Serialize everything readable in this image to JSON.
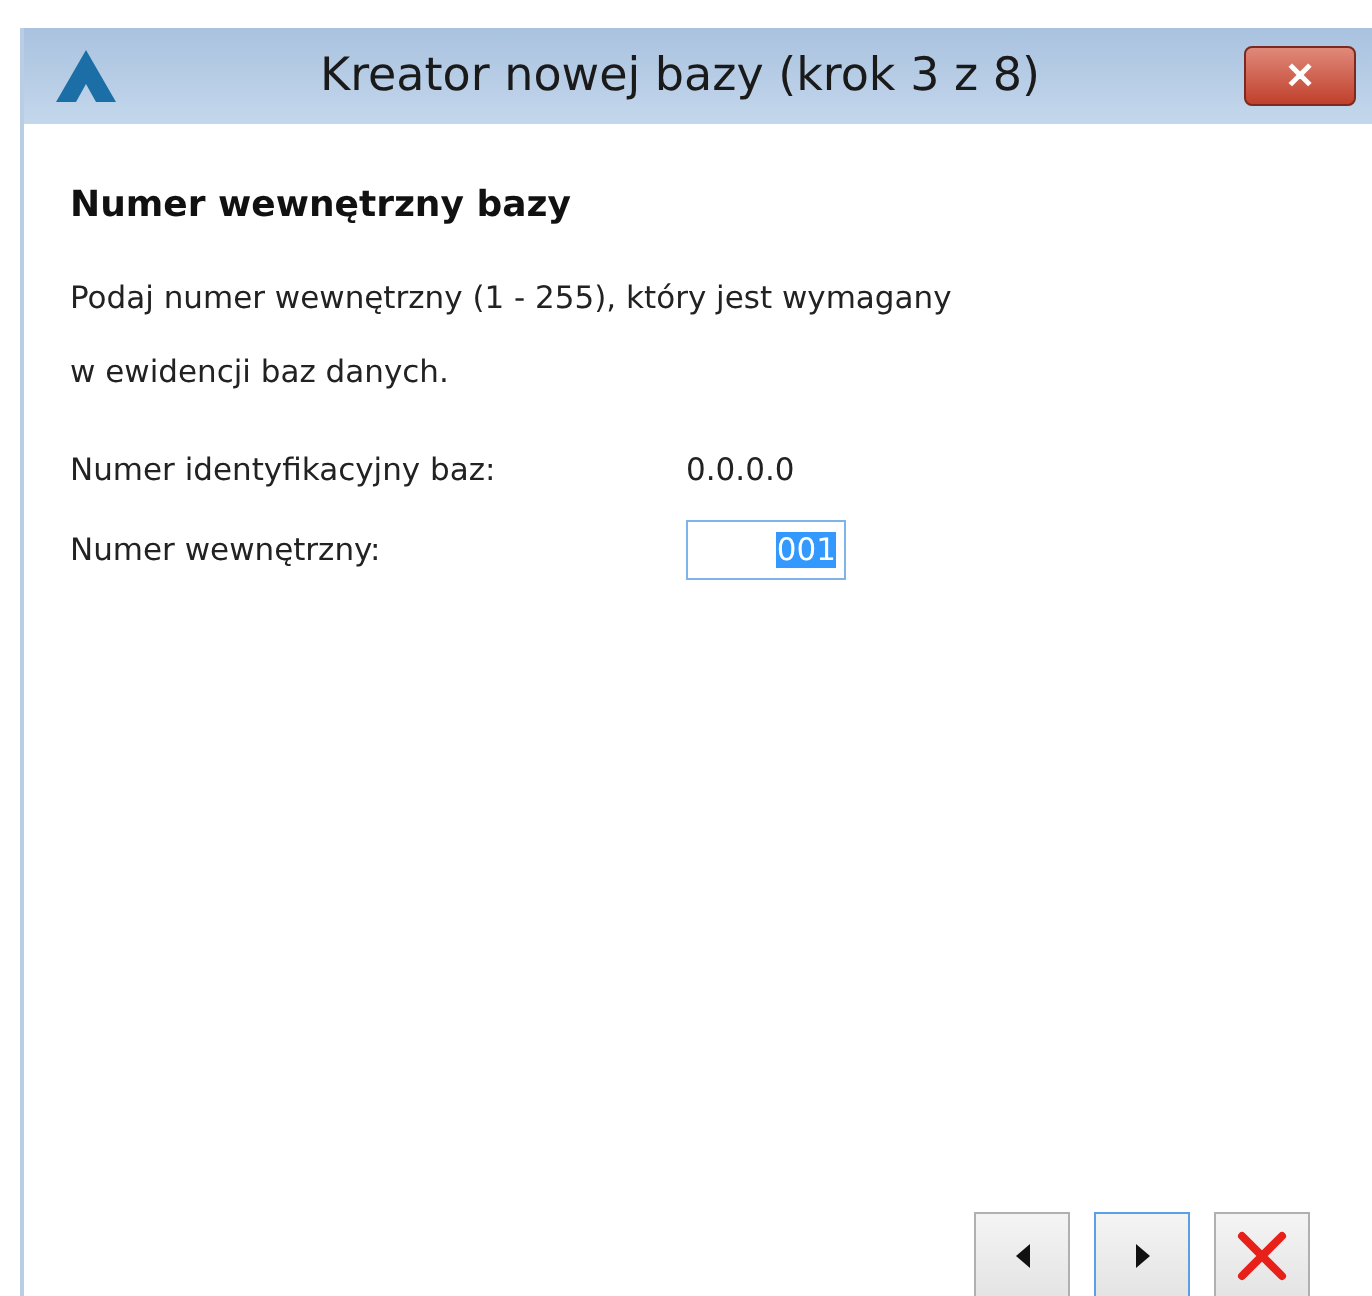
{
  "window": {
    "title": "Kreator nowej bazy (krok 3 z 8)",
    "close_glyph": "✕"
  },
  "heading": "Numer wewnętrzny bazy",
  "description": [
    "Podaj numer wewnętrzny (1 - 255), który jest wymagany",
    "w ewidencji baz danych."
  ],
  "fields": [
    {
      "kind": "readonly",
      "label": "Numer identyfikacyjny baz:",
      "value": "0.0.0.0"
    },
    {
      "kind": "input",
      "label": "Numer wewnętrzny:",
      "value": "001",
      "text_selected": true
    }
  ],
  "buttons": [
    {
      "kind": "back",
      "focused": false
    },
    {
      "kind": "next",
      "focused": true
    },
    {
      "kind": "cancel",
      "focused": false
    }
  ]
}
